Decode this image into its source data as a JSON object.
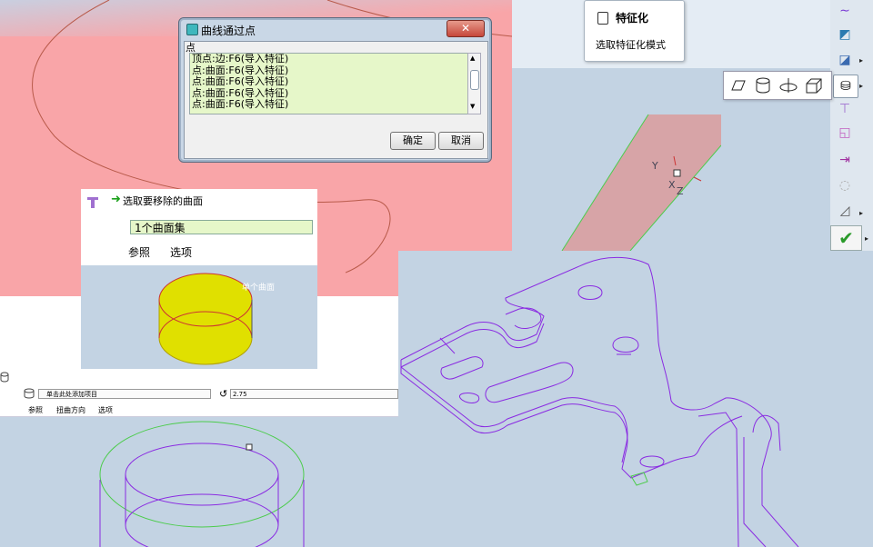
{
  "dialog": {
    "title": "曲线通过点",
    "close": "✕",
    "point_label": "点",
    "rows": [
      "顶点:边:F6(导入特征)",
      "点:曲面:F6(导入特征)",
      "点:曲面:F6(导入特征)",
      "点:曲面:F6(导入特征)",
      "点:曲面:F6(导入特征)"
    ],
    "ok": "确定",
    "cancel": "取消"
  },
  "tooltip": {
    "title": "特征化",
    "description": "选取特征化模式"
  },
  "remove_panel": {
    "prompt": "选取要移除的曲面",
    "field_value": "1个曲面集",
    "tab_refs": "参照",
    "tab_options": "选项",
    "viewport_label": "单个曲面"
  },
  "twist_panel": {
    "field_placeholder": "单击此处添加项目",
    "value": "2.75",
    "tabs": [
      "参照",
      "扭曲方向",
      "选项"
    ]
  },
  "coord_labels": {
    "y": "Y",
    "x": "X",
    "z": "Z"
  },
  "colors": {
    "pink_viewport": "#f9a5a8",
    "model_bg": "#c3d3e3",
    "list_bg": "#e6f7c9",
    "surface_yellow": "#e0e000",
    "wire_purple": "#8a2be2",
    "wire_green": "#4ccc4c"
  }
}
